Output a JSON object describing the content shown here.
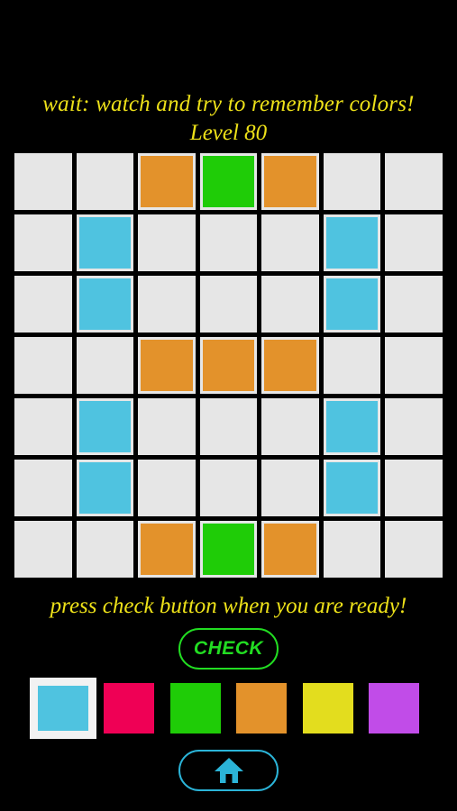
{
  "app": {
    "background": "#000000"
  },
  "header": {
    "hint": "wait: watch and try to remember colors!",
    "level_label": "Level 80",
    "text_color": "#EDE119"
  },
  "grid": {
    "rows": 7,
    "cols": 7,
    "empty_color": "#E6E6E6",
    "gap_color": "#000000",
    "cells": [
      [
        "empty",
        "empty",
        "orange",
        "green",
        "orange",
        "empty",
        "empty"
      ],
      [
        "empty",
        "cyan",
        "empty",
        "empty",
        "empty",
        "cyan",
        "empty"
      ],
      [
        "empty",
        "cyan",
        "empty",
        "empty",
        "empty",
        "cyan",
        "empty"
      ],
      [
        "empty",
        "empty",
        "orange",
        "orange",
        "orange",
        "empty",
        "empty"
      ],
      [
        "empty",
        "cyan",
        "empty",
        "empty",
        "empty",
        "cyan",
        "empty"
      ],
      [
        "empty",
        "cyan",
        "empty",
        "empty",
        "empty",
        "cyan",
        "empty"
      ],
      [
        "empty",
        "empty",
        "orange",
        "green",
        "orange",
        "empty",
        "empty"
      ]
    ],
    "color_map": {
      "empty": "#E6E6E6",
      "cyan": "#4FC3E0",
      "green": "#1FCC07",
      "orange": "#E3922B",
      "pink": "#EF0055",
      "yellow": "#E3DD1E",
      "purple": "#C14CE8"
    }
  },
  "footer": {
    "ready_text": "press check button when you are ready!",
    "check_label": "CHECK",
    "check_color": "#22DD22"
  },
  "palette": {
    "selected_index": 0,
    "swatches": [
      {
        "name": "cyan",
        "color": "#4FC3E0"
      },
      {
        "name": "pink",
        "color": "#EF0055"
      },
      {
        "name": "green",
        "color": "#1FCC07"
      },
      {
        "name": "orange",
        "color": "#E3922B"
      },
      {
        "name": "yellow",
        "color": "#E3DD1E"
      },
      {
        "name": "purple",
        "color": "#C14CE8"
      }
    ],
    "selection_border_color": "#F2F2F2"
  },
  "home": {
    "icon": "home-icon",
    "color": "#2BB4D8"
  }
}
